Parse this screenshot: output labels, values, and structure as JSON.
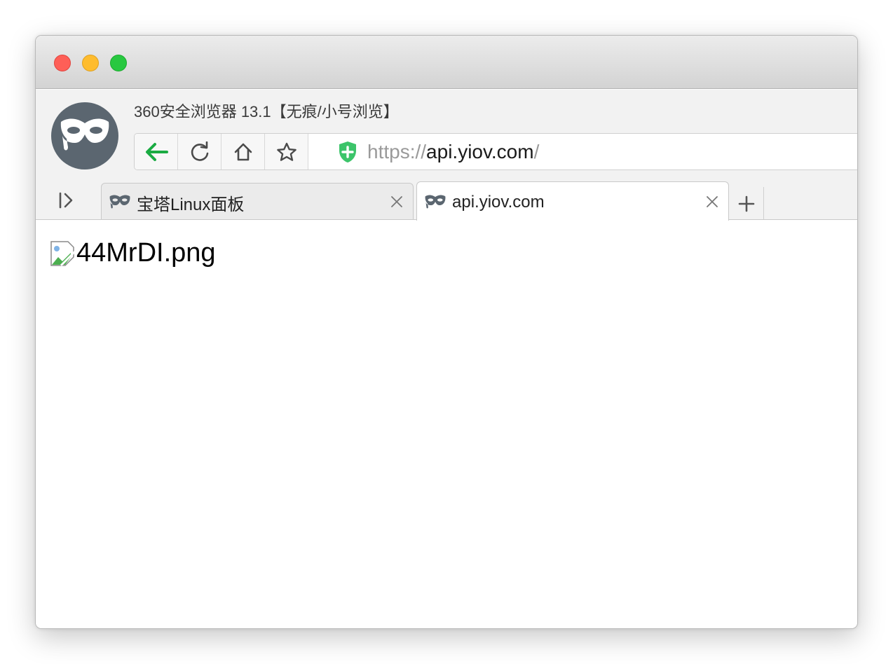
{
  "window": {
    "title": "360安全浏览器 13.1【无痕/小号浏览】"
  },
  "navigation": {
    "back_icon": "back-arrow-icon",
    "reload_icon": "reload-icon",
    "home_icon": "home-icon",
    "bookmark_icon": "star-icon"
  },
  "address_bar": {
    "security_icon": "shield-plus-icon",
    "scheme": "https://",
    "host": "api.yiov.com",
    "path": "/"
  },
  "tabs": [
    {
      "title": "宝塔Linux面板",
      "active": false,
      "icon": "mask-icon"
    },
    {
      "title": "api.yiov.com",
      "active": true,
      "icon": "mask-icon"
    }
  ],
  "content": {
    "image_alt": "44MrDI.png"
  },
  "colors": {
    "back_arrow": "#1aab42",
    "security_shield": "#3cc46a",
    "avatar_bg": "#5b6670"
  }
}
